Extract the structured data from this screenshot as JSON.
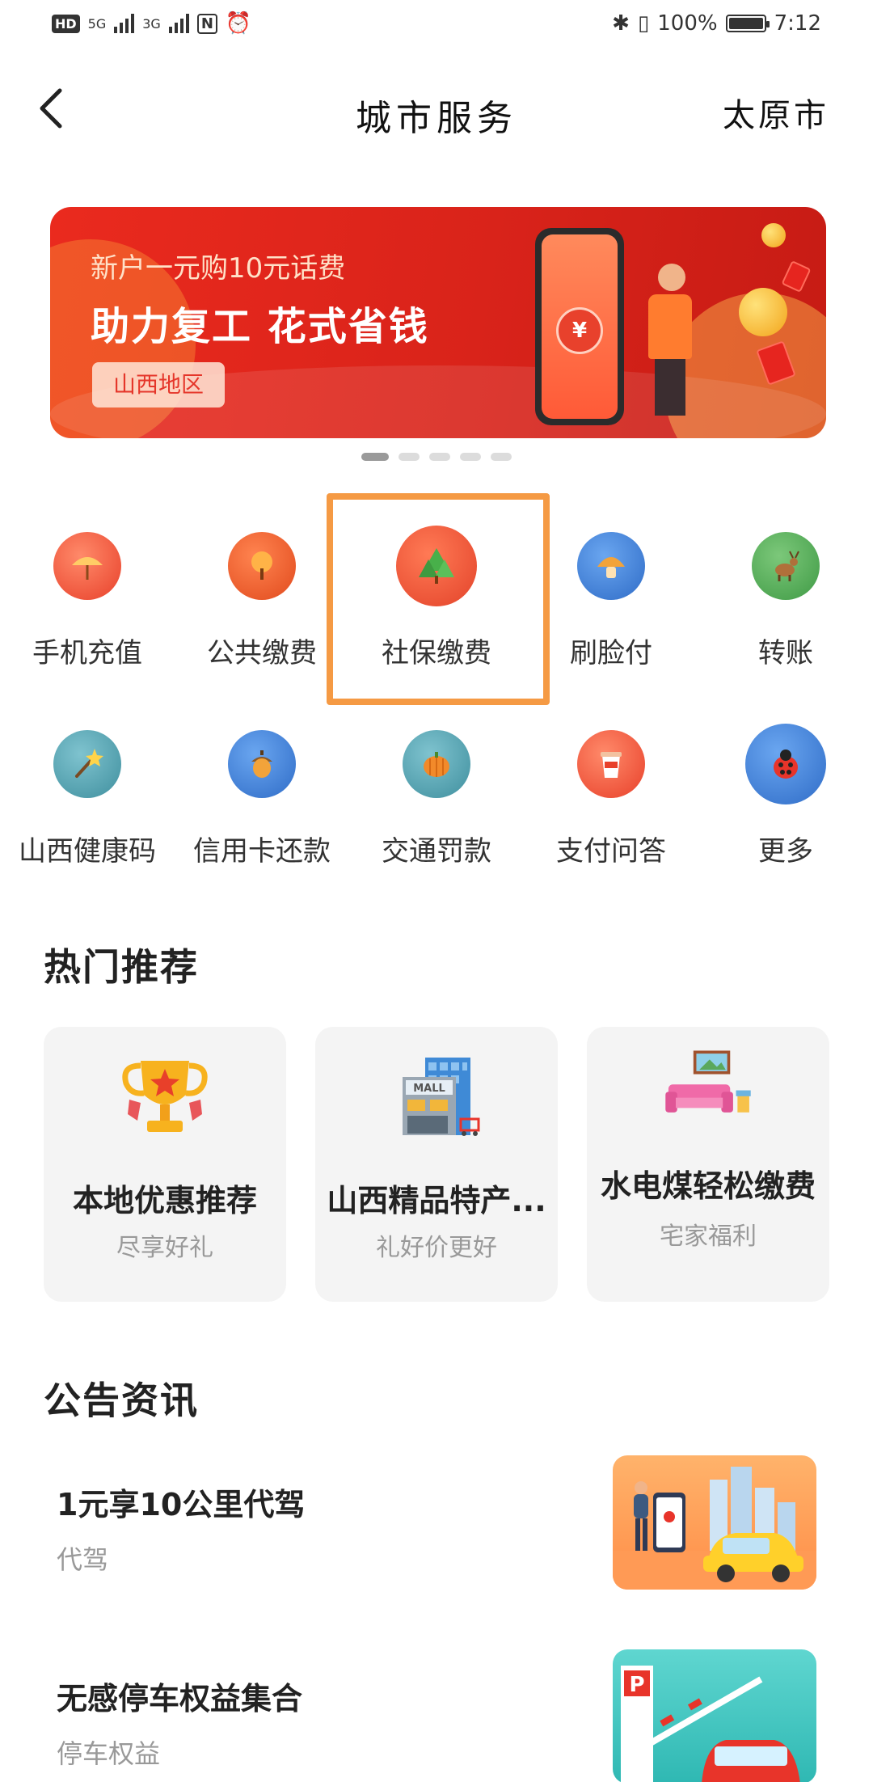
{
  "status_bar": {
    "badge": "HD",
    "network_1": "5G",
    "network_2": "3G",
    "battery_text": "100%",
    "battery_level": 1.0,
    "time": "7:12"
  },
  "header": {
    "title": "城市服务",
    "city": "太原市"
  },
  "banner": {
    "subtitle": "新户一元购10元话费",
    "headline": "助力复工 花式省钱",
    "tag": "山西地区",
    "slide_count": 5,
    "active_slide": 1,
    "colors": {
      "background": "#e02a1f",
      "tag_text": "#e5362a"
    }
  },
  "services": [
    {
      "label": "手机充值",
      "icon": "umbrella-icon",
      "color": "#f05a3f",
      "highlighted": false
    },
    {
      "label": "公共缴费",
      "icon": "tree-orange-icon",
      "color": "#ef5a2e",
      "highlighted": false
    },
    {
      "label": "社保缴费",
      "icon": "tree-green-icon",
      "color": "#ee5a34",
      "highlighted": true
    },
    {
      "label": "刷脸付",
      "icon": "mushroom-icon",
      "color": "#3f7fd6",
      "highlighted": false
    },
    {
      "label": "转账",
      "icon": "deer-icon",
      "color": "#5aa85c",
      "highlighted": false
    },
    {
      "label": "山西健康码",
      "icon": "magic-wand-icon",
      "color": "#4aa0b0",
      "highlighted": false
    },
    {
      "label": "信用卡还款",
      "icon": "acorn-icon",
      "color": "#3f7fd6",
      "highlighted": false
    },
    {
      "label": "交通罚款",
      "icon": "pumpkin-icon",
      "color": "#4aa0b0",
      "highlighted": false
    },
    {
      "label": "支付问答",
      "icon": "cup-icon",
      "color": "#f05a3f",
      "highlighted": false
    },
    {
      "label": "更多",
      "icon": "ladybug-icon",
      "color": "#3f7fd6",
      "highlighted": false
    }
  ],
  "hot": {
    "title": "热门推荐",
    "cards": [
      {
        "title": "本地优惠推荐",
        "subtitle": "尽享好礼",
        "icon": "trophy-icon"
      },
      {
        "title": "山西精品特产...",
        "subtitle": "礼好价更好",
        "icon": "mall-icon"
      },
      {
        "title": "水电煤轻松缴费",
        "subtitle": "宅家福利",
        "icon": "sofa-icon"
      }
    ]
  },
  "news": {
    "title": "公告资讯",
    "items": [
      {
        "title": "1元享10公里代驾",
        "tag": "代驾",
        "image": "driver-car-illustration"
      },
      {
        "title": "无感停车权益集合",
        "tag": "停车权益",
        "image": "parking-illustration"
      }
    ]
  },
  "colors": {
    "highlight_border": "#f59a44",
    "card_bg": "#f4f4f4"
  }
}
